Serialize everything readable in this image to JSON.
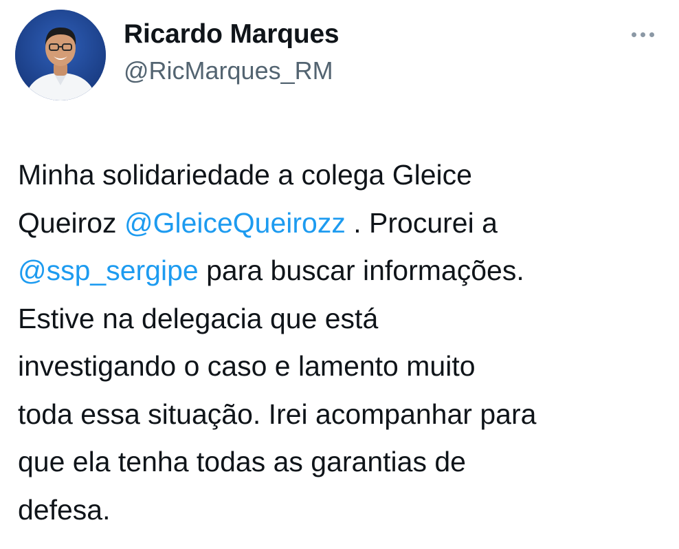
{
  "author": {
    "display_name": "Ricardo Marques",
    "handle": "@RicMarques_RM",
    "avatar_icon": "profile-photo"
  },
  "menu": {
    "more_icon": "more-horizontal-icon"
  },
  "colors": {
    "text": "#0f1419",
    "secondary": "#536471",
    "link": "#1d9bf0"
  },
  "tweet": {
    "line1": "Minha solidariedade a colega Gleice",
    "line2_pre": "Queiroz ",
    "mention1": "@GleiceQueirozz",
    "line2_post": " . Procurei a",
    "mention2": "@ssp_sergipe",
    "line3_post": " para buscar informações.",
    "line4": "Estive na delegacia que está",
    "line5": "investigando o caso e lamento muito",
    "line6": "toda essa situação. Irei acompanhar para",
    "line7": "que ela tenha todas as garantias de",
    "line8": "defesa."
  }
}
